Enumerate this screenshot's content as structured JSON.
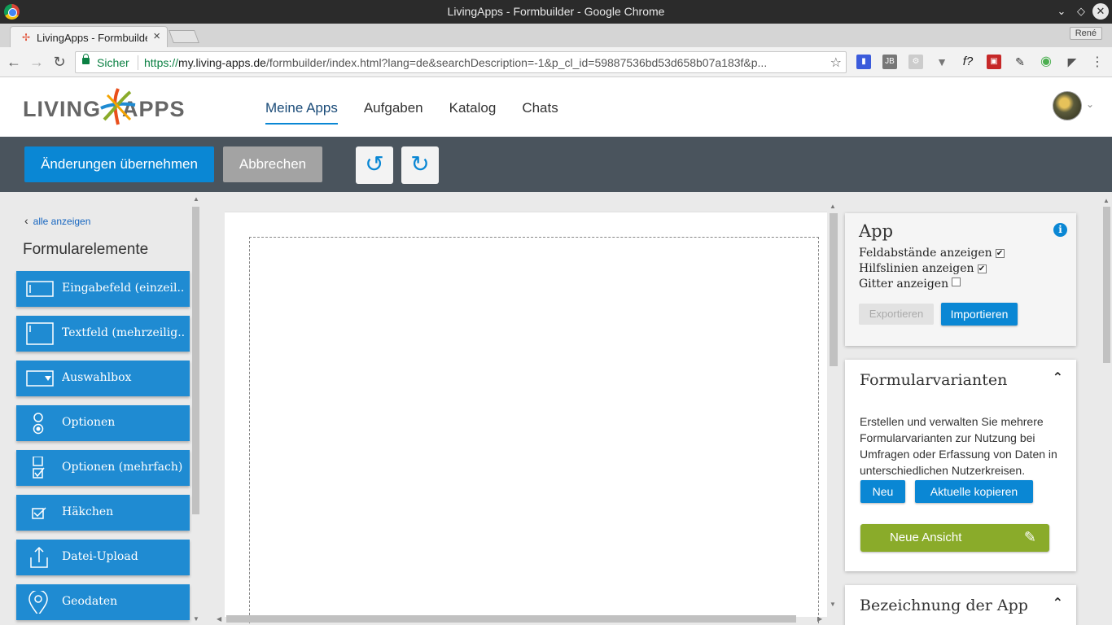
{
  "window": {
    "title": "LivingApps - Formbuilder - Google Chrome"
  },
  "tab": {
    "title": "LivingApps - Formbuilder",
    "profile": "René"
  },
  "address": {
    "secure_label": "Sicher",
    "scheme": "https://",
    "host": "my.living-apps.de",
    "path": "/formbuilder/index.html?lang=de&searchDescription=-1&p_cl_id=59887536bd53d658b07a183f&p..."
  },
  "header": {
    "logo_text_left": "LIVING",
    "logo_text_right": "APPS",
    "nav": [
      "Meine Apps",
      "Aufgaben",
      "Katalog",
      "Chats"
    ]
  },
  "actions": {
    "apply": "Änderungen übernehmen",
    "cancel": "Abbrechen"
  },
  "sidebar": {
    "back": "alle anzeigen",
    "title": "Formularelemente",
    "items": [
      {
        "label": "Eingabefeld (einzeil...",
        "icon": "textfield-icon"
      },
      {
        "label": "Textfeld (mehrzeilig...",
        "icon": "textarea-icon"
      },
      {
        "label": "Auswahlbox",
        "icon": "select-icon"
      },
      {
        "label": "Optionen",
        "icon": "radio-icon"
      },
      {
        "label": "Optionen (mehrfach)",
        "icon": "multi-checkbox-icon"
      },
      {
        "label": "Häkchen",
        "icon": "checkbox-icon"
      },
      {
        "label": "Datei-Upload",
        "icon": "upload-icon"
      },
      {
        "label": "Geodaten",
        "icon": "location-pin-icon"
      }
    ]
  },
  "app_panel": {
    "title": "App",
    "options": [
      {
        "label": "Feldabstände anzeigen",
        "checked": true
      },
      {
        "label": "Hilfslinien anzeigen",
        "checked": true
      },
      {
        "label": "Gitter anzeigen",
        "checked": false
      }
    ],
    "export": "Exportieren",
    "import": "Importieren"
  },
  "variants_panel": {
    "title": "Formularvarianten",
    "description": "Erstellen und verwalten Sie mehrere Formularvarianten zur Nutzung bei Umfragen oder Erfassung von Daten in unterschiedlichen Nutzerkreisen.",
    "new": "Neu",
    "copy": "Aktuelle kopieren",
    "new_view": "Neue Ansicht"
  },
  "name_panel": {
    "title": "Bezeichnung der App"
  },
  "colors": {
    "accent": "#0a87d4",
    "green": "#8aab2a",
    "actionbar": "#4a545d"
  }
}
